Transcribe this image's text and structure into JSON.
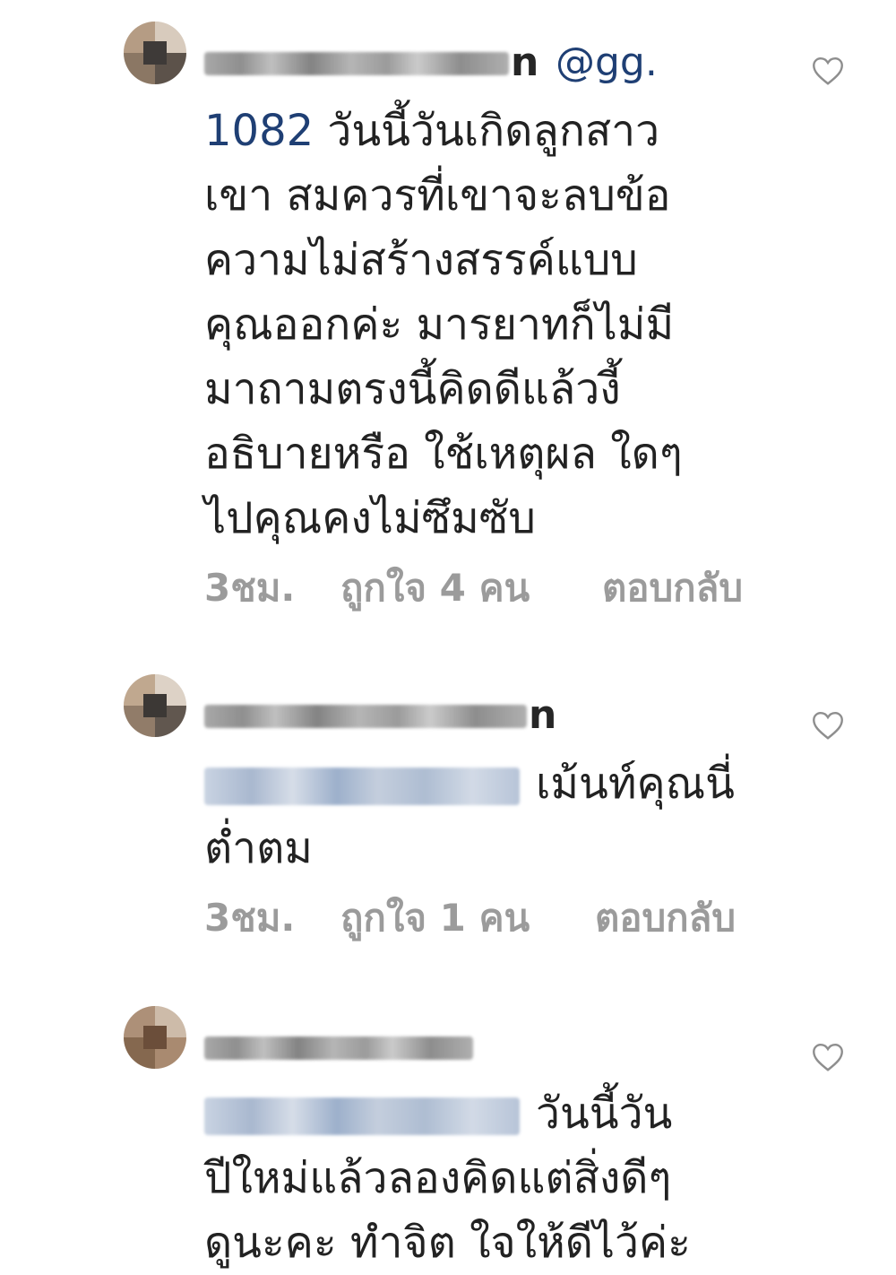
{
  "comments": [
    {
      "username_visible_tail": "n",
      "mention_visible": "@gg.",
      "text_first_prefix": "1082",
      "text_first_rest": " วันนี้วันเกิดลูกสาว",
      "text_rest": "เขา สมควรที่เขาจะลบข้อ\nความไม่สร้างสรรค์แบบ\nคุณออกค่ะ มารยาทก็ไม่มี\nมาถามตรงนี้คิดดีแล้วงี้\nอธิบายหรือ ใช้เหตุผล ใดๆ\nไปคุณคงไม่ซึมซับ",
      "time": "3ชม.",
      "likes": "ถูกใจ 4 คน",
      "reply": "ตอบกลับ",
      "heart_icon": "heart-outline-icon"
    },
    {
      "username_visible_tail": "n",
      "text_first_rest": "เม้นท์คุณนี่",
      "text_rest": "ต่ำตม",
      "time": "3ชม.",
      "likes": "ถูกใจ 1 คน",
      "reply": "ตอบกลับ",
      "heart_icon": "heart-outline-icon"
    },
    {
      "text_first_rest": "วันนี้วัน",
      "text_rest": "ปีใหม่แล้วลองคิดแต่สิ่งดีๆ\nดูนะคะ ทำจิต ใจให้ดีไว้ค่ะ",
      "heart_icon": "heart-outline-icon"
    }
  ]
}
